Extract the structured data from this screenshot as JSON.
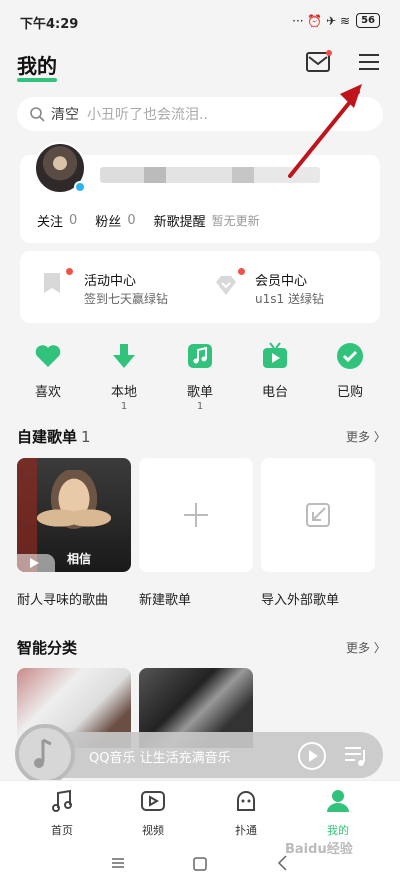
{
  "status_bar": {
    "time": "下午4:29",
    "icons": "··· ⏰ ✈ ≋",
    "battery": "56"
  },
  "header": {
    "title": "我的",
    "mail_icon": "mail-icon",
    "menu_icon": "menu-icon"
  },
  "search": {
    "clear_label": "清空",
    "placeholder": "小丑听了也会流泪.."
  },
  "profile": {
    "follow_label": "关注",
    "follow_count": "0",
    "fans_label": "粉丝",
    "fans_count": "0",
    "new_song_label": "新歌提醒",
    "new_song_status": "暂无更新"
  },
  "activities": [
    {
      "title": "活动中心",
      "subtitle": "签到七天赢绿钻"
    },
    {
      "title": "会员中心",
      "subtitle": "u1s1 送绿钻"
    }
  ],
  "quick_links": [
    {
      "label": "喜欢",
      "count": ""
    },
    {
      "label": "本地",
      "count": "1"
    },
    {
      "label": "歌单",
      "count": "1"
    },
    {
      "label": "电台",
      "count": ""
    },
    {
      "label": "已购",
      "count": ""
    }
  ],
  "my_playlists": {
    "title": "自建歌单",
    "count": "1",
    "more": "更多 〉",
    "cover_text": "相信",
    "items": [
      "耐人寻味的歌曲",
      "新建歌单",
      "导入外部歌单"
    ]
  },
  "smart_category": {
    "title": "智能分类",
    "more": "更多 〉"
  },
  "player": {
    "text": "QQ音乐 让生活充满音乐"
  },
  "bottom_nav": [
    {
      "label": "首页"
    },
    {
      "label": "视频"
    },
    {
      "label": "扑通"
    },
    {
      "label": "我的"
    }
  ],
  "watermark": "Baidu经验",
  "colors": {
    "accent": "#31c27c",
    "annotation": "#c0141c"
  }
}
